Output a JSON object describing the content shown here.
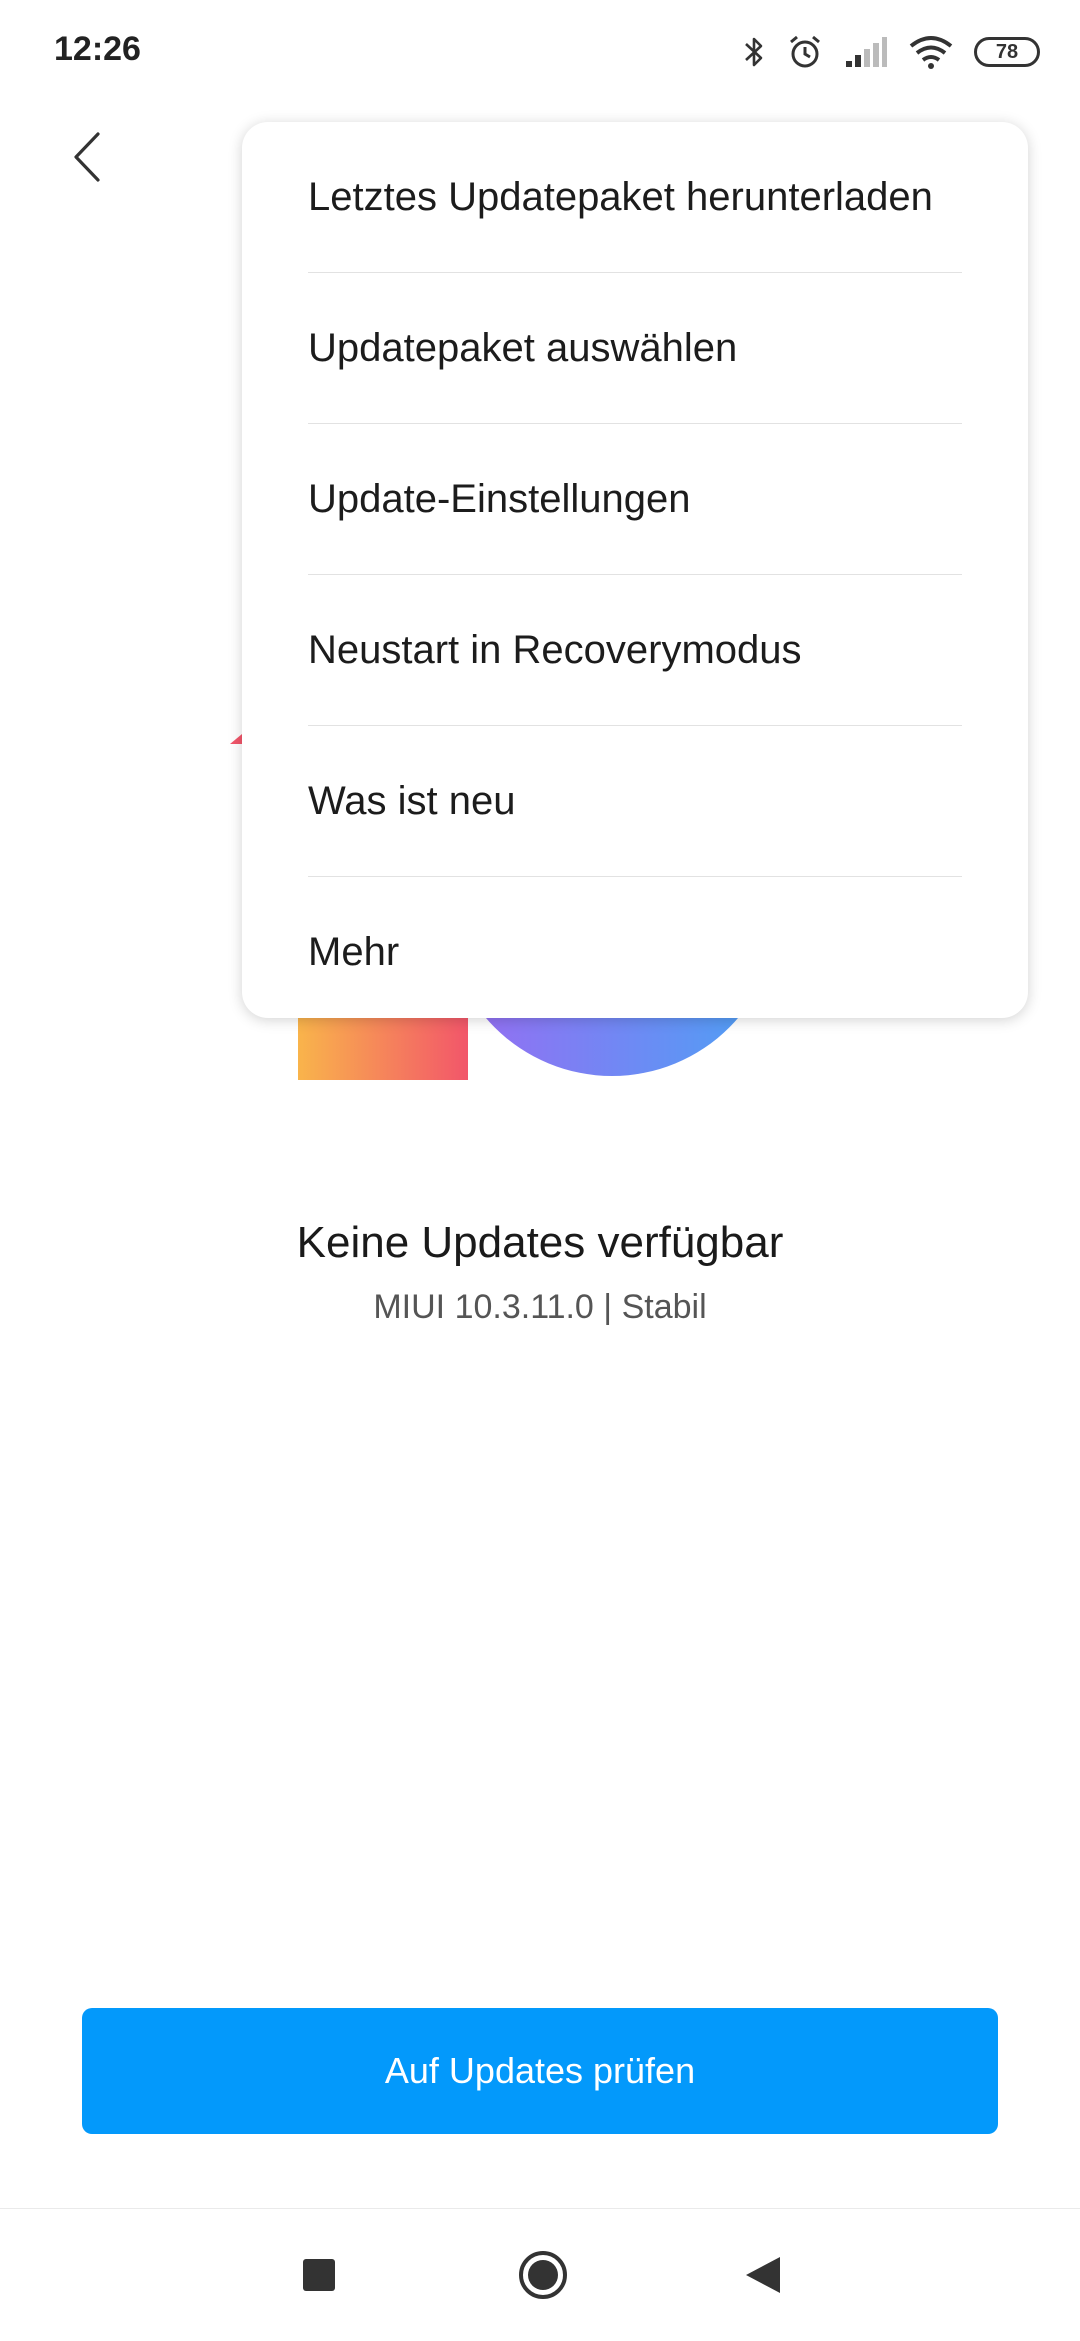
{
  "status_bar": {
    "time": "12:26",
    "battery": "78",
    "icons": [
      "bluetooth-icon",
      "alarm-icon",
      "signal-icon",
      "wifi-icon",
      "battery-icon"
    ]
  },
  "menu": {
    "items": [
      "Letztes Updatepaket herunterladen",
      "Updatepaket auswählen",
      "Update-Einstellungen",
      "Neustart in Recoverymodus",
      "Was ist neu",
      "Mehr"
    ]
  },
  "update_status": {
    "title": "Keine Updates verfügbar",
    "version": "MIUI 10.3.11.0 | Stabil"
  },
  "actions": {
    "check_button": "Auf Updates prüfen"
  },
  "colors": {
    "primary": "#0399fb",
    "background": "#ffffff"
  },
  "nav_bar": {
    "icons": [
      "recents-icon",
      "home-icon",
      "back-icon"
    ]
  }
}
